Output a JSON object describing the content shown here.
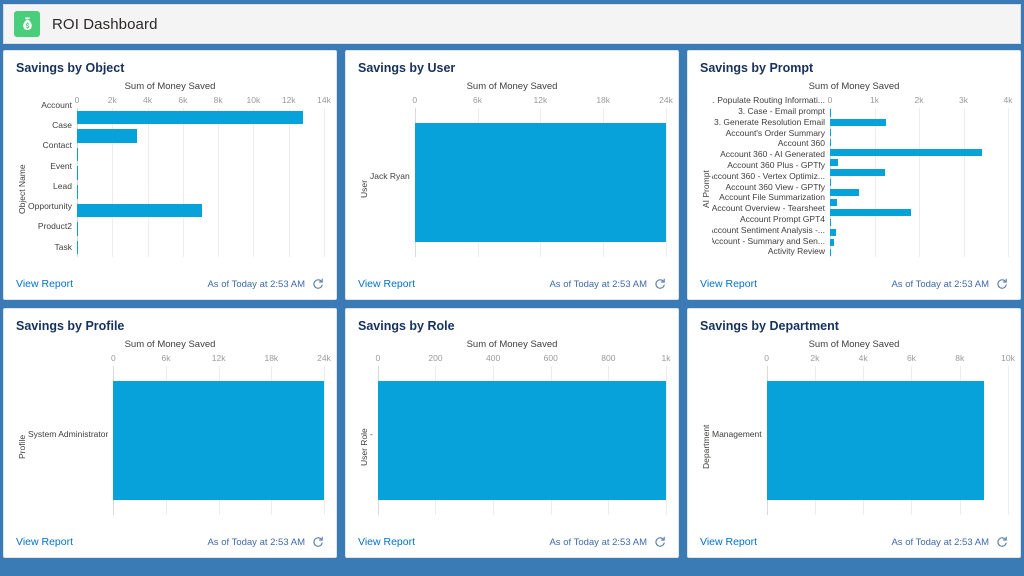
{
  "header": {
    "title": "ROI Dashboard",
    "icon": "money-bag-icon",
    "icon_color": "#4bce7b"
  },
  "common": {
    "view_report_label": "View Report",
    "as_of_label": "As of Today at 2:53 AM",
    "refresh_icon": "refresh-icon",
    "bar_color": "#08a2db"
  },
  "panels": [
    {
      "title": "Savings by Object"
    },
    {
      "title": "Savings by User"
    },
    {
      "title": "Savings by Prompt"
    },
    {
      "title": "Savings by Profile"
    },
    {
      "title": "Savings by Role"
    },
    {
      "title": "Savings by Department"
    }
  ],
  "chart_data": [
    {
      "type": "bar",
      "orientation": "horizontal",
      "title": "Savings by Object",
      "xlabel": "Sum of Money Saved",
      "ylabel": "Object Name",
      "categories": [
        "Account",
        "Case",
        "Contact",
        "Event",
        "Lead",
        "Opportunity",
        "Product2",
        "Task"
      ],
      "values": [
        12800,
        3400,
        60,
        10,
        40,
        7100,
        5,
        55
      ],
      "ticks": [
        "0",
        "2k",
        "4k",
        "6k",
        "8k",
        "10k",
        "12k",
        "14k"
      ],
      "tick_values": [
        0,
        2000,
        4000,
        6000,
        8000,
        10000,
        12000,
        14000
      ],
      "xlim": [
        0,
        14000
      ],
      "grid": true,
      "legend": "none"
    },
    {
      "type": "bar",
      "orientation": "horizontal",
      "title": "Savings by User",
      "xlabel": "Sum of Money Saved",
      "ylabel": "User",
      "categories": [
        "Jack Ryan"
      ],
      "values": [
        24000
      ],
      "ticks": [
        "0",
        "6k",
        "12k",
        "18k",
        "24k"
      ],
      "tick_values": [
        0,
        6000,
        12000,
        18000,
        24000
      ],
      "xlim": [
        0,
        24000
      ],
      "grid": true,
      "legend": "none"
    },
    {
      "type": "bar",
      "orientation": "horizontal",
      "title": "Savings by Prompt",
      "xlabel": "Sum of Money Saved",
      "ylabel": "AI Prompt",
      "categories": [
        "1. Populate Routing Informati...",
        "3. Case - Email prompt",
        "3. Generate Resolution Email",
        "Account's Order Summary",
        "Account 360",
        "Account 360 - AI Generated",
        "Account 360 Plus - GPTfy",
        "Account 360 - Vertex Optimiz...",
        "Account 360 View - GPTfy",
        "Account File Summarization",
        "Account Overview - Tearsheet",
        "Account Prompt GPT4",
        "Account Sentiment Analysis -...",
        "Account - Summary and Sen...",
        "Activity Review"
      ],
      "values": [
        20,
        1260,
        30,
        8,
        3420,
        170,
        1240,
        25,
        660,
        150,
        1820,
        15,
        140,
        95,
        10
      ],
      "ticks": [
        "0",
        "1k",
        "2k",
        "3k",
        "4k"
      ],
      "tick_values": [
        0,
        1000,
        2000,
        3000,
        4000
      ],
      "xlim": [
        0,
        4000
      ],
      "grid": true,
      "legend": "none"
    },
    {
      "type": "bar",
      "orientation": "horizontal",
      "title": "Savings by Profile",
      "xlabel": "Sum of Money Saved",
      "ylabel": "Profile",
      "categories": [
        "System Administrator"
      ],
      "values": [
        24000
      ],
      "ticks": [
        "0",
        "6k",
        "12k",
        "18k",
        "24k"
      ],
      "tick_values": [
        0,
        6000,
        12000,
        18000,
        24000
      ],
      "xlim": [
        0,
        24000
      ],
      "grid": true,
      "legend": "none"
    },
    {
      "type": "bar",
      "orientation": "horizontal",
      "title": "Savings by Role",
      "xlabel": "Sum of Money Saved",
      "ylabel": "User Role",
      "categories": [
        "-"
      ],
      "values": [
        1000
      ],
      "ticks": [
        "0",
        "200",
        "400",
        "600",
        "800",
        "1k"
      ],
      "tick_values": [
        0,
        200,
        400,
        600,
        800,
        1000
      ],
      "xlim": [
        0,
        1000
      ],
      "grid": true,
      "legend": "none"
    },
    {
      "type": "bar",
      "orientation": "horizontal",
      "title": "Savings by Department",
      "xlabel": "Sum of Money Saved",
      "ylabel": "Department",
      "categories": [
        "Management"
      ],
      "values": [
        9000
      ],
      "ticks": [
        "0",
        "2k",
        "4k",
        "6k",
        "8k",
        "10k"
      ],
      "tick_values": [
        0,
        2000,
        4000,
        6000,
        8000,
        10000
      ],
      "xlim": [
        0,
        10000
      ],
      "grid": true,
      "legend": "none"
    }
  ]
}
